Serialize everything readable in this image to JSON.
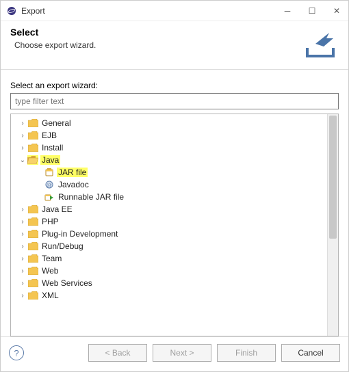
{
  "window": {
    "title": "Export"
  },
  "header": {
    "title": "Select",
    "subtitle": "Choose export wizard."
  },
  "filter": {
    "prompt": "Select an export wizard:",
    "placeholder": "type filter text"
  },
  "tree": {
    "items": [
      {
        "label": "General",
        "expanded": false,
        "highlight": false,
        "depth": 1,
        "kind": "folder"
      },
      {
        "label": "EJB",
        "expanded": false,
        "highlight": false,
        "depth": 1,
        "kind": "folder"
      },
      {
        "label": "Install",
        "expanded": false,
        "highlight": false,
        "depth": 1,
        "kind": "folder"
      },
      {
        "label": "Java",
        "expanded": true,
        "highlight": true,
        "depth": 1,
        "kind": "folder-open"
      },
      {
        "label": "JAR file",
        "expanded": null,
        "highlight": true,
        "depth": 2,
        "kind": "jar"
      },
      {
        "label": "Javadoc",
        "expanded": null,
        "highlight": false,
        "depth": 2,
        "kind": "javadoc"
      },
      {
        "label": "Runnable JAR file",
        "expanded": null,
        "highlight": false,
        "depth": 2,
        "kind": "runnable-jar"
      },
      {
        "label": "Java EE",
        "expanded": false,
        "highlight": false,
        "depth": 1,
        "kind": "folder"
      },
      {
        "label": "PHP",
        "expanded": false,
        "highlight": false,
        "depth": 1,
        "kind": "folder"
      },
      {
        "label": "Plug-in Development",
        "expanded": false,
        "highlight": false,
        "depth": 1,
        "kind": "folder"
      },
      {
        "label": "Run/Debug",
        "expanded": false,
        "highlight": false,
        "depth": 1,
        "kind": "folder"
      },
      {
        "label": "Team",
        "expanded": false,
        "highlight": false,
        "depth": 1,
        "kind": "folder"
      },
      {
        "label": "Web",
        "expanded": false,
        "highlight": false,
        "depth": 1,
        "kind": "folder"
      },
      {
        "label": "Web Services",
        "expanded": false,
        "highlight": false,
        "depth": 1,
        "kind": "folder"
      },
      {
        "label": "XML",
        "expanded": false,
        "highlight": false,
        "depth": 1,
        "kind": "folder"
      }
    ]
  },
  "buttons": {
    "back": "< Back",
    "next": "Next >",
    "finish": "Finish",
    "cancel": "Cancel"
  },
  "icons": {
    "folder": "folder-icon",
    "folder-open": "folder-open-icon",
    "jar": "jar-file-icon",
    "javadoc": "javadoc-icon",
    "runnable-jar": "runnable-jar-icon"
  }
}
